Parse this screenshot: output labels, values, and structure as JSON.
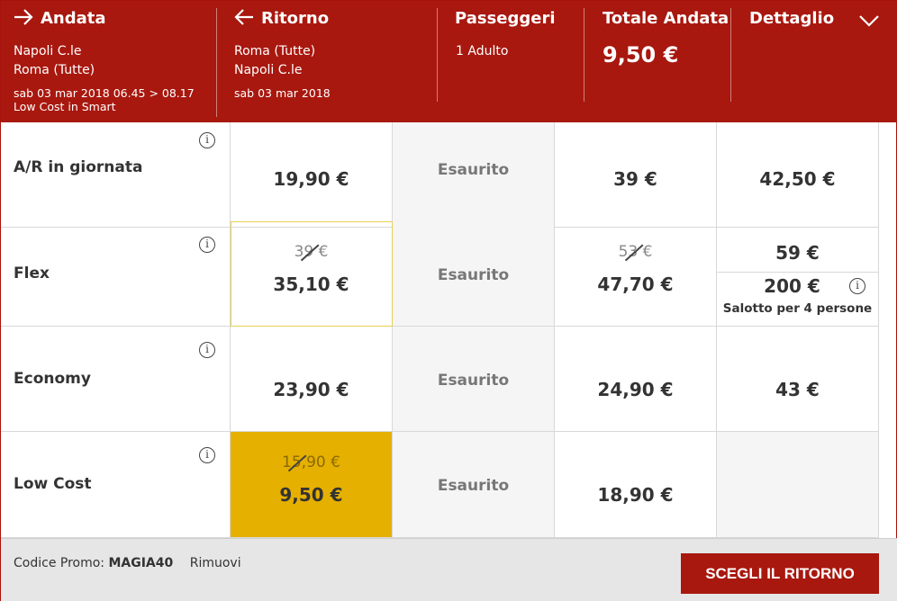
{
  "header": {
    "andata": {
      "title": "Andata",
      "from": "Napoli C.le",
      "to": "Roma (Tutte)",
      "datetime": "sab 03 mar 2018 06.45 > 08.17",
      "fare": "Low Cost in Smart"
    },
    "ritorno": {
      "title": "Ritorno",
      "from": "Roma (Tutte)",
      "to": "Napoli C.le",
      "date": "sab 03 mar 2018"
    },
    "passeggeri": {
      "title": "Passeggeri",
      "value": "1 Adulto"
    },
    "totale": {
      "title": "Totale Andata",
      "value": "9,50 €"
    },
    "dettaglio": {
      "title": "Dettaglio"
    }
  },
  "rows": [
    {
      "label": "A/R in giornata",
      "cells": [
        {
          "price": "19,90 €"
        },
        {
          "status": "Esaurito"
        },
        {
          "price": "39 €"
        },
        {
          "price": "42,50 €"
        }
      ]
    },
    {
      "label": "Flex",
      "cells": [
        {
          "old_price": "39 €",
          "price": "35,10 €"
        },
        {
          "status": "Esaurito"
        },
        {
          "old_price": "53 €",
          "price": "47,70 €"
        },
        {
          "price": "59 €",
          "extra_price": "200 €",
          "extra_note": "Salotto per 4 persone"
        }
      ]
    },
    {
      "label": "Economy",
      "cells": [
        {
          "price": "23,90 €"
        },
        {
          "status": "Esaurito"
        },
        {
          "price": "24,90 €"
        },
        {
          "price": "43 €"
        }
      ]
    },
    {
      "label": "Low Cost",
      "cells": [
        {
          "old_price": "15,90 €",
          "price": "9,50 €"
        },
        {
          "status": "Esaurito"
        },
        {
          "price": "18,90 €"
        },
        {
          "price": ""
        }
      ]
    }
  ],
  "info_symbol": "i",
  "footer": {
    "promo_label": "Codice Promo:",
    "promo_code": "MAGIA40",
    "remove_label": "Rimuovi",
    "cta_label": "SCEGLI IL RITORNO"
  },
  "colors": {
    "brand_red": "#a8180f",
    "selected_yellow": "#e6b000",
    "sold_out_bg": "#f5f5f5"
  }
}
